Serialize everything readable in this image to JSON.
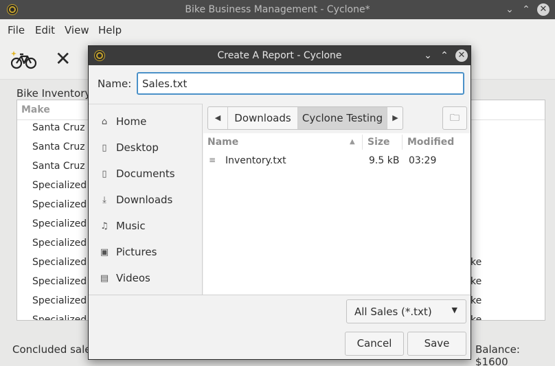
{
  "main": {
    "title": "Bike Business Management - Cyclone*",
    "window_controls": {
      "minimize": "⌄",
      "maximize": "⌃",
      "close": "✕"
    },
    "menu": [
      "File",
      "Edit",
      "View",
      "Help"
    ],
    "inventory_label": "Bike Inventory",
    "table": {
      "column_make": "Make",
      "makes": [
        "Santa Cruz",
        "Santa Cruz",
        "Santa Cruz",
        "Specialized",
        "Specialized",
        "Specialized",
        "Specialized",
        "Specialized",
        "Specialized",
        "Specialized",
        "Specialized"
      ],
      "visible_kind_fragments": [
        "ke",
        "ke",
        "ke",
        "ke"
      ]
    },
    "status": "Concluded sale",
    "balance": "Balance: $1600"
  },
  "dialog": {
    "title": "Create A Report - Cyclone",
    "name_label": "Name:",
    "name_value": "Sales.txt",
    "places": [
      {
        "label": "Home",
        "icon": "home-icon"
      },
      {
        "label": "Desktop",
        "icon": "desktop-icon"
      },
      {
        "label": "Documents",
        "icon": "documents-icon"
      },
      {
        "label": "Downloads",
        "icon": "downloads-icon"
      },
      {
        "label": "Music",
        "icon": "music-icon"
      },
      {
        "label": "Pictures",
        "icon": "pictures-icon"
      },
      {
        "label": "Videos",
        "icon": "videos-icon"
      }
    ],
    "path": [
      "Downloads",
      "Cyclone Testing"
    ],
    "columns": {
      "name": "Name",
      "size": "Size",
      "modified": "Modified"
    },
    "files": [
      {
        "name": "Inventory.txt",
        "size": "9.5 kB",
        "modified": "03:29"
      }
    ],
    "filter": "All Sales (*.txt)",
    "cancel": "Cancel",
    "save": "Save"
  }
}
